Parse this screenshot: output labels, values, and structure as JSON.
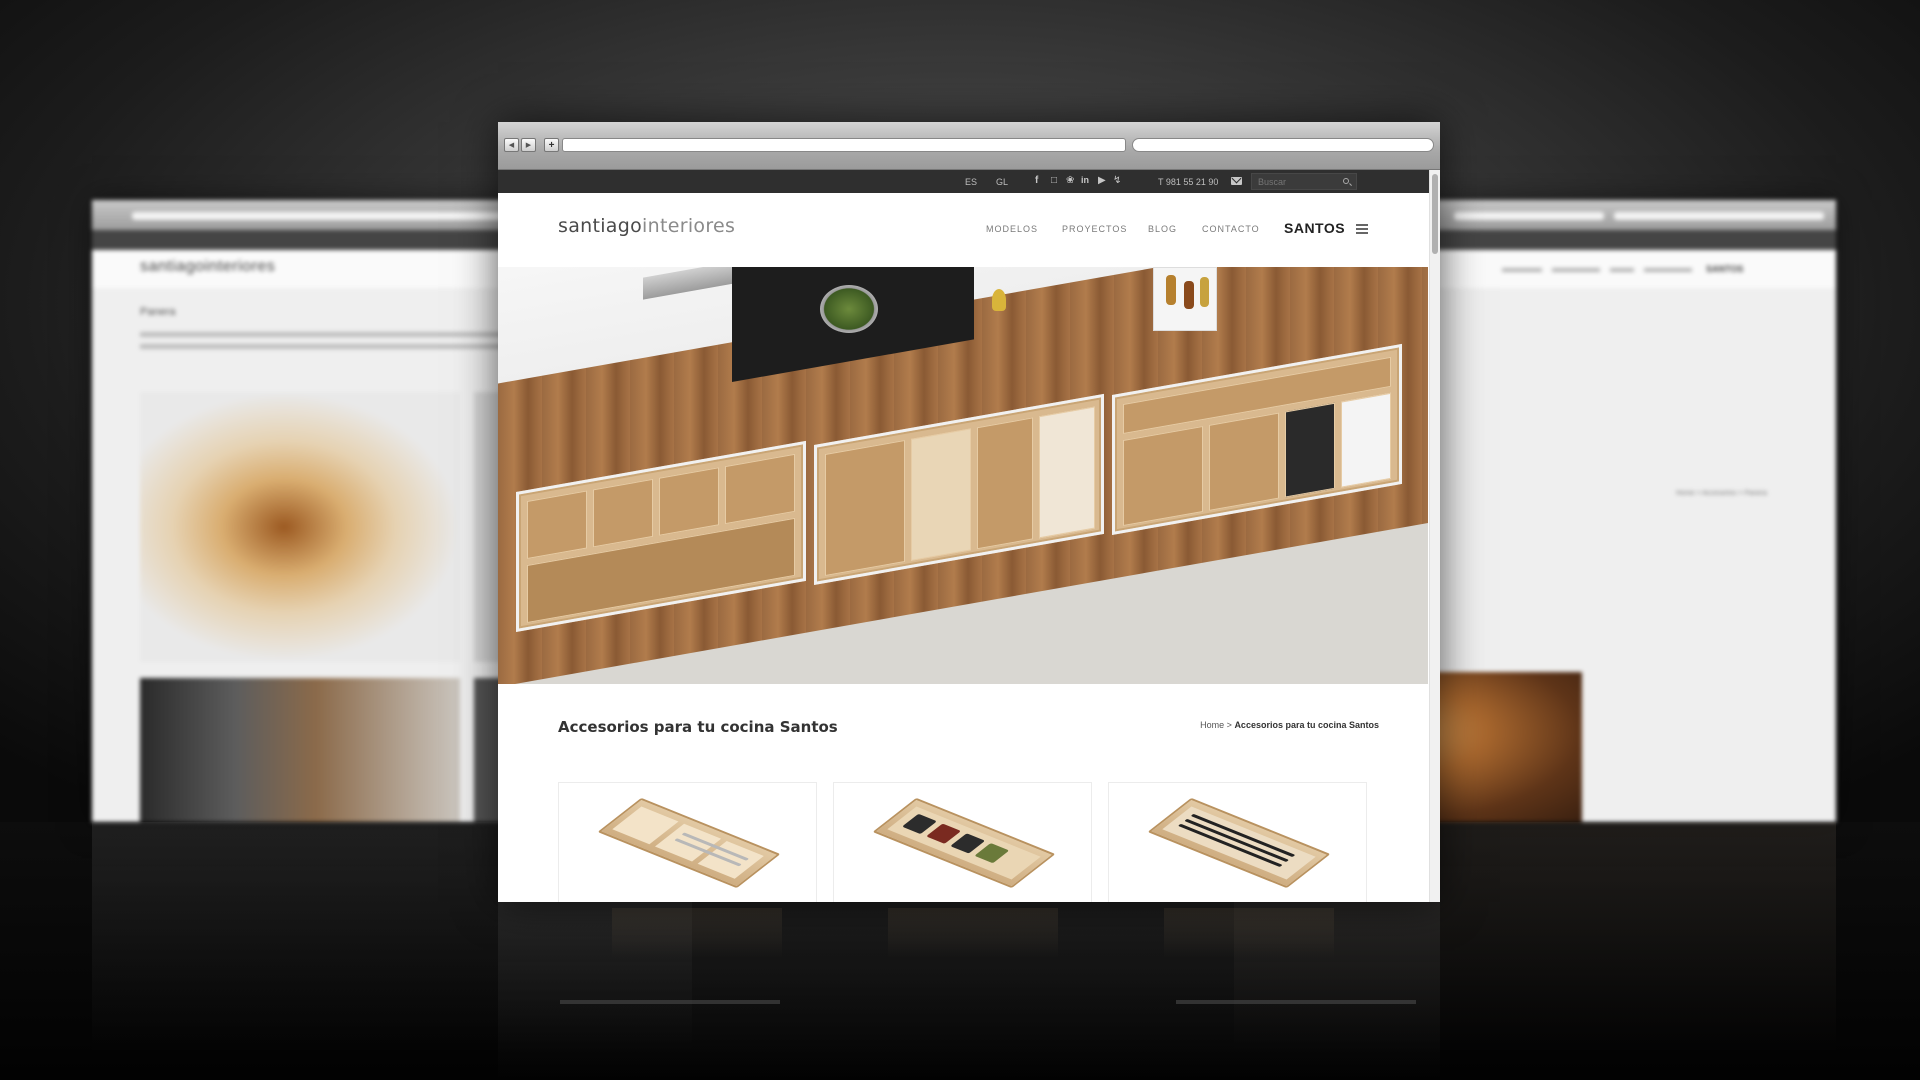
{
  "background": {
    "left_window": {
      "logo": "santiagointeriores",
      "title": "Panera"
    },
    "right_window": {
      "breadcrumb": "Home > Accesorios > Panera",
      "brand": "SANTOS"
    }
  },
  "browser": {
    "nav_back_icon": "triangle-left",
    "nav_forward_icon": "triangle-right",
    "new_tab_label": "+",
    "url": "",
    "search": ""
  },
  "topbar": {
    "languages": [
      "ES",
      "GL"
    ],
    "social_icons": [
      "facebook-icon",
      "instagram-icon",
      "twitter-icon",
      "linkedin-icon",
      "youtube-icon",
      "issuu-icon"
    ],
    "phone": "T 981 55 21 90",
    "search_placeholder": "Buscar"
  },
  "header": {
    "logo_main": "santiago",
    "logo_sub": "interiores",
    "menu": [
      "MODELOS",
      "PROYECTOS",
      "BLOG",
      "CONTACTO"
    ],
    "brand": "SANTOS"
  },
  "page": {
    "title": "Accesorios para tu cocina Santos",
    "breadcrumb": {
      "home": "Home",
      "separator": ">",
      "current": "Accesorios para tu cocina Santos"
    }
  },
  "colors": {
    "topbar_bg": "#2f2f2f",
    "accent_wood": "#d9b98f",
    "text_dark": "#333333"
  }
}
